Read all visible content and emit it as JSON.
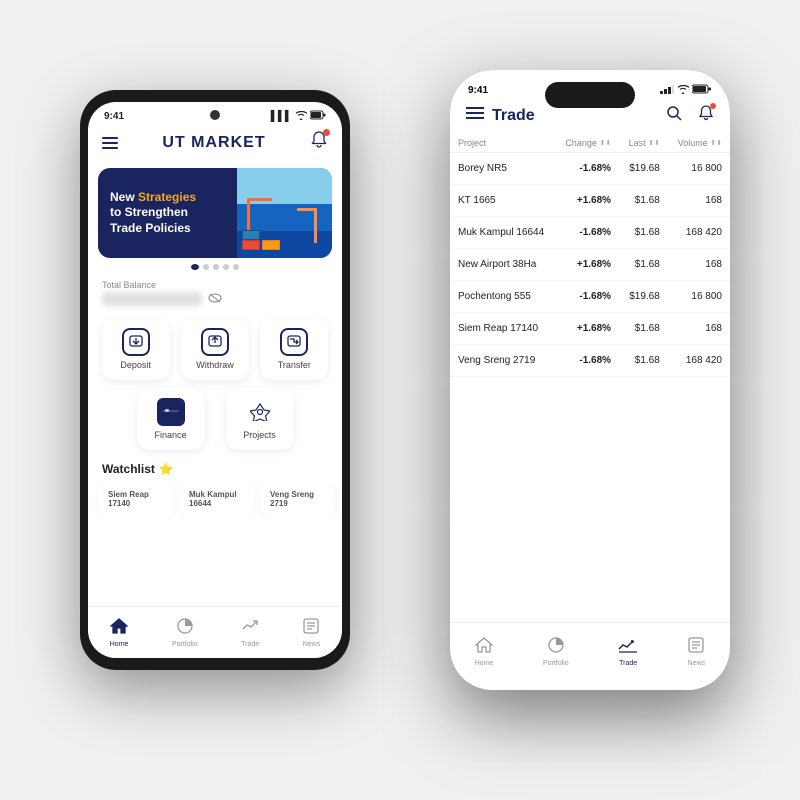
{
  "leftPhone": {
    "statusBar": {
      "time": "9:41",
      "signal": "▌▌▌",
      "wifi": "WiFi",
      "battery": "🔋"
    },
    "header": {
      "title": "UT ",
      "titleBold": "MARKET",
      "menuIcon": "☰",
      "bellIcon": "🔔"
    },
    "banner": {
      "textNormal": "New ",
      "textHighlight": "Strategies",
      "textRest": "to Strengthen\nTrade Policies"
    },
    "balance": {
      "label": "Total Balance",
      "value": "**********"
    },
    "actions": [
      {
        "icon": "⬆",
        "label": "Deposit"
      },
      {
        "icon": "⬇",
        "label": "Withdraw"
      },
      {
        "icon": "⇄",
        "label": "Transfer"
      }
    ],
    "actions2": [
      {
        "icon": "💳",
        "label": "Finance"
      },
      {
        "icon": "◈",
        "label": "Projects"
      }
    ],
    "watchlist": {
      "title": "Watchlist",
      "star": "⭐",
      "items": [
        {
          "name": "Siem Reap\n17140"
        },
        {
          "name": "Muk Kampul\n16644"
        },
        {
          "name": "Veng Sreng 2719"
        }
      ]
    },
    "bottomNav": [
      {
        "icon": "⌂",
        "label": "Home",
        "active": true
      },
      {
        "icon": "◑",
        "label": "Portfolio",
        "active": false
      },
      {
        "icon": "⇄",
        "label": "Trade",
        "active": false
      },
      {
        "icon": "📄",
        "label": "News",
        "active": false
      }
    ]
  },
  "rightPhone": {
    "statusBar": {
      "time": "9:41",
      "signal": "▌▌",
      "wifi": "WiFi",
      "battery": "🔋"
    },
    "header": {
      "menuIcon": "☰",
      "title": "Trade",
      "searchIcon": "🔍",
      "bellIcon": "🔔"
    },
    "table": {
      "columns": [
        {
          "label": "Project"
        },
        {
          "label": "Change",
          "sortable": true
        },
        {
          "label": "Last",
          "sortable": true
        },
        {
          "label": "Volume",
          "sortable": true
        }
      ],
      "rows": [
        {
          "project": "Borey NR5",
          "change": "-1.68%",
          "changeType": "neg",
          "last": "$19.68",
          "volume": "16 800"
        },
        {
          "project": "KT 1665",
          "change": "+1.68%",
          "changeType": "pos",
          "last": "$1.68",
          "volume": "168"
        },
        {
          "project": "Muk Kampul 16644",
          "change": "-1.68%",
          "changeType": "neg",
          "last": "$1.68",
          "volume": "168 420"
        },
        {
          "project": "New Airport 38Ha",
          "change": "+1.68%",
          "changeType": "pos",
          "last": "$1.68",
          "volume": "168"
        },
        {
          "project": "Pochentong 555",
          "change": "-1.68%",
          "changeType": "neg",
          "last": "$19.68",
          "volume": "16 800"
        },
        {
          "project": "Siem Reap 17140",
          "change": "+1.68%",
          "changeType": "pos",
          "last": "$1.68",
          "volume": "168"
        },
        {
          "project": "Veng Sreng 2719",
          "change": "-1.68%",
          "changeType": "neg",
          "last": "$1.68",
          "volume": "168 420"
        }
      ]
    },
    "bottomNav": [
      {
        "icon": "⌂",
        "label": "Home",
        "active": false
      },
      {
        "icon": "◑",
        "label": "Portfolio",
        "active": false
      },
      {
        "icon": "⇄",
        "label": "Trade",
        "active": true
      },
      {
        "icon": "📄",
        "label": "News",
        "active": false
      }
    ]
  }
}
